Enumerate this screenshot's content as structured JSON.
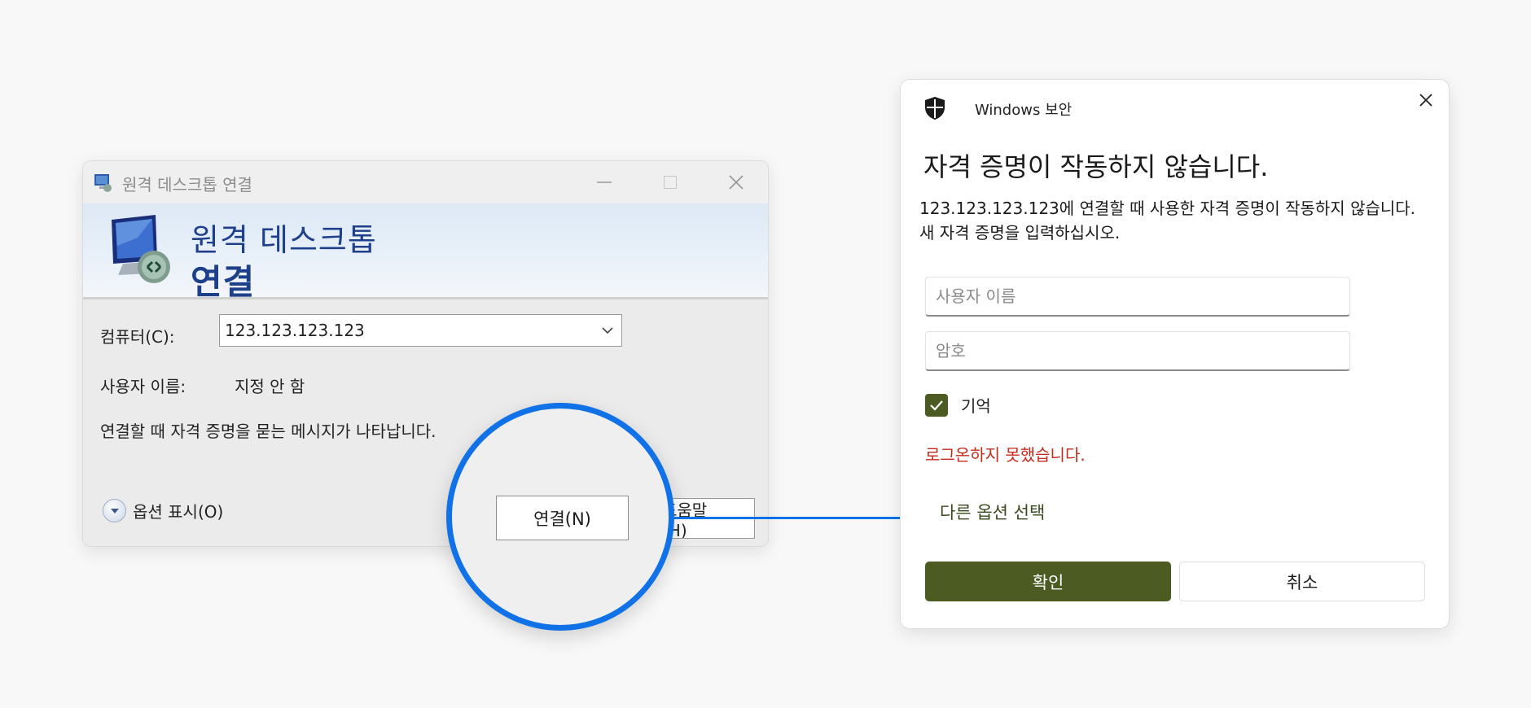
{
  "rdc": {
    "title": "원격 데스크톱 연결",
    "banner_line1": "원격 데스크톱",
    "banner_line2": "연결",
    "computer_label": "컴퓨터(C):",
    "computer_value": "123.123.123.123",
    "username_label": "사용자 이름:",
    "username_value": "지정 안 함",
    "message": "연결할 때 자격 증명을 묻는 메시지가 나타납니다.",
    "show_options": "옵션 표시(O)",
    "connect_button": "연결(N)",
    "help_button": "도움말(H)"
  },
  "security": {
    "app_title": "Windows 보안",
    "heading": "자격 증명이 작동하지 않습니다.",
    "description": "123.123.123.123에 연결할 때 사용한 자격 증명이 작동하지 않습니다. 새 자격 증명을 입력하십시오.",
    "username_placeholder": "사용자 이름",
    "password_placeholder": "암호",
    "remember_label": "기억",
    "remember_checked": true,
    "error_message": "로그온하지 못했습니다.",
    "more_options": "다른 옵션 선택",
    "ok_button": "확인",
    "cancel_button": "취소"
  },
  "icons": {
    "rdc_title": "remote-desktop-icon",
    "rdc_banner": "monitor-connection-icon",
    "security": "shield-icon",
    "close": "close-icon",
    "chevron": "chevron-down-icon",
    "checkbox": "checkmark-icon"
  },
  "colors": {
    "accent_blue": "#1072e6",
    "banner_text": "#1e3f8a",
    "ok_button": "#4b5b22",
    "error": "#c42b1c"
  }
}
